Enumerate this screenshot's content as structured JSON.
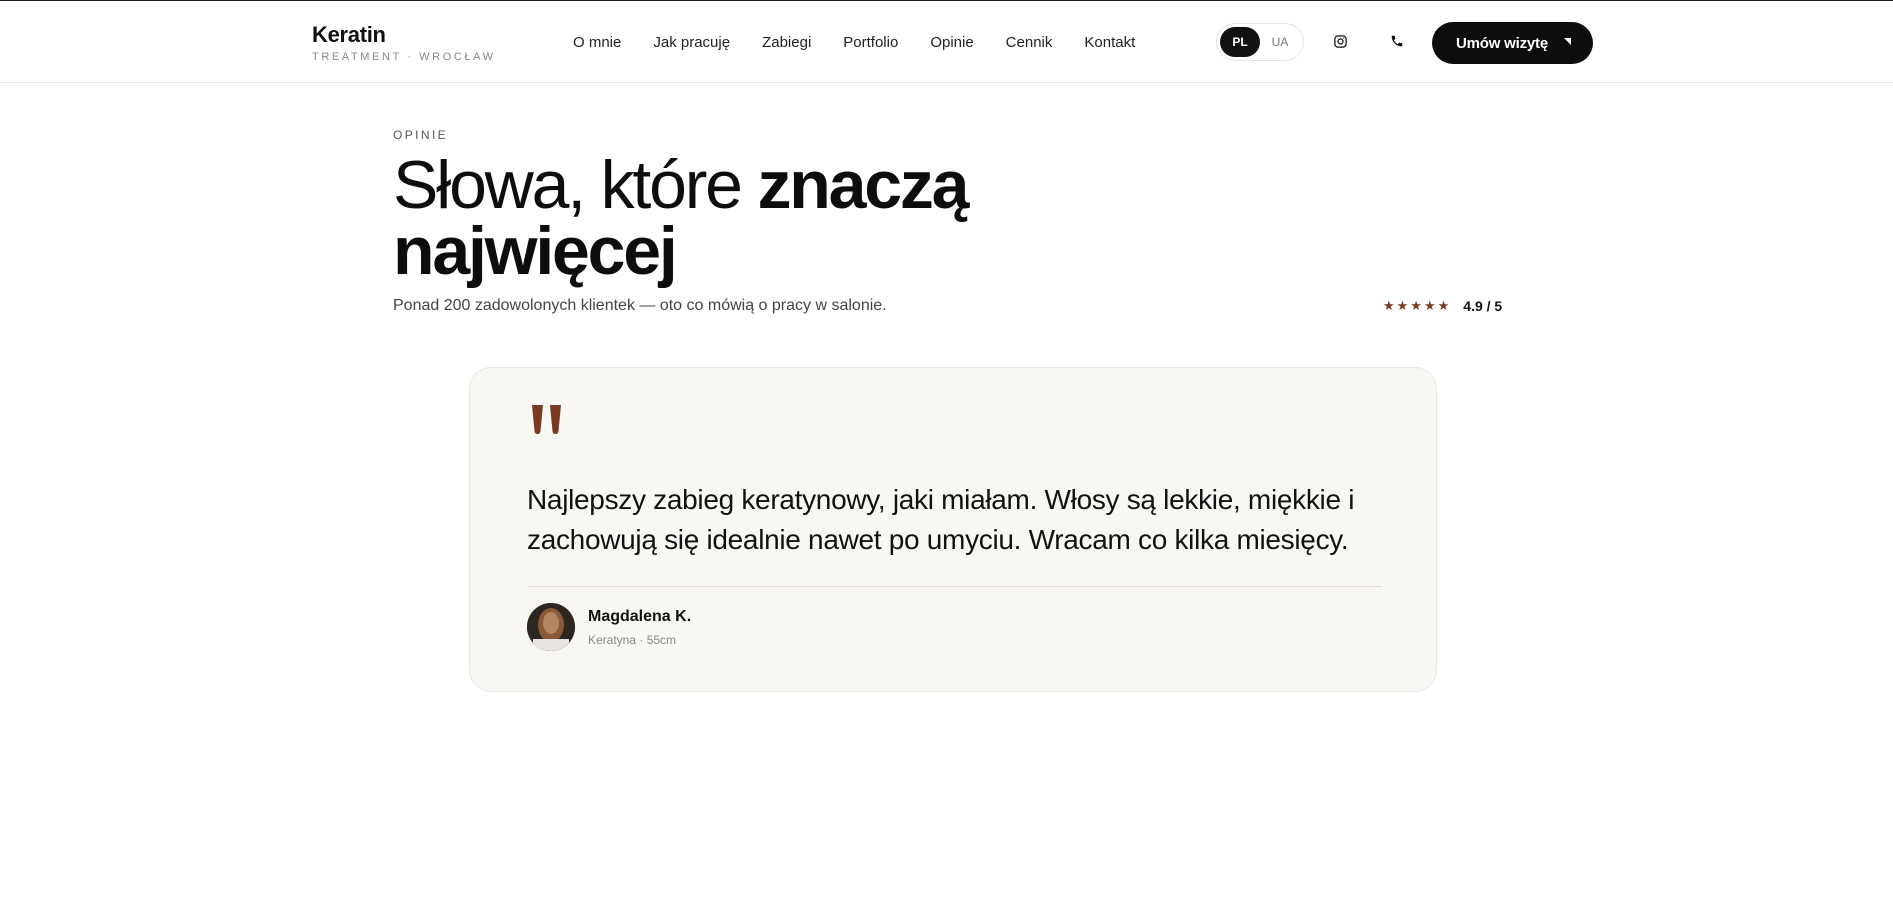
{
  "brand": {
    "name": "Keratin",
    "tagline": "TREATMENT · WROCŁAW"
  },
  "nav": {
    "items": [
      {
        "label": "O mnie"
      },
      {
        "label": "Jak pracuję"
      },
      {
        "label": "Zabiegi"
      },
      {
        "label": "Portfolio"
      },
      {
        "label": "Opinie"
      },
      {
        "label": "Cennik"
      },
      {
        "label": "Kontakt"
      }
    ]
  },
  "language": {
    "active": "PL",
    "inactive": "UA"
  },
  "icons": {
    "instagram": "instagram-icon",
    "phone": "phone-icon",
    "arrow": "arrow-up-right-icon",
    "quote": "quote-icon"
  },
  "cta": {
    "label": "Umów wizytę"
  },
  "section": {
    "eyebrow": "OPINIE",
    "headline_regular": "Słowa, które ",
    "headline_bold_1": "znaczą",
    "headline_bold_2": "najwięcej",
    "subtitle": "Ponad 200 zadowolonych klientek — oto co mówią o pracy w salonie.",
    "rating": {
      "stars": "★★★★★",
      "score": "4.9 / 5",
      "value": 4.9,
      "max": 5
    }
  },
  "testimonial": {
    "quote": "Najlepszy zabieg keratynowy, jaki miałam. Włosy są lekkie, miękkie i zachowują się idealnie nawet po umyciu. Wracam co kilka miesięcy.",
    "author": "Magdalena K.",
    "meta": "Keratyna · 55cm"
  },
  "colors": {
    "accent": "#7a3a22",
    "dark": "#0d0d0d",
    "card_bg": "#f8f7f3",
    "muted": "#888888"
  }
}
